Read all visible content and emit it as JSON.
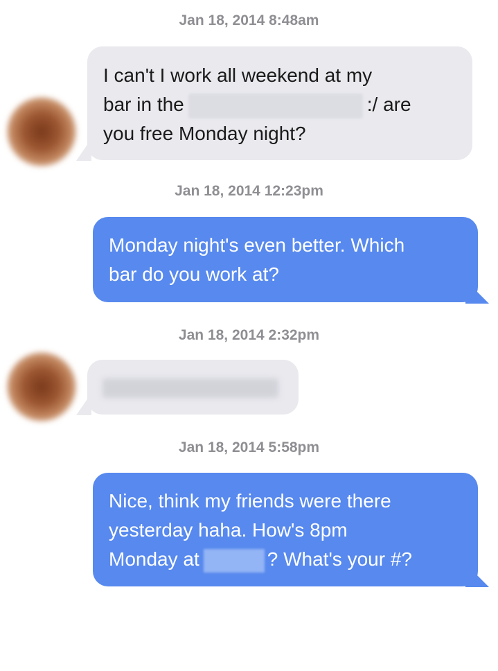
{
  "conversation": {
    "messages": [
      {
        "timestamp": "Jan 18, 2014 8:48am",
        "sender": "them",
        "line1": "I can't I work all weekend at my",
        "line2_before": "bar in the",
        "line2_after": ":/ are",
        "line3": "you free Monday night?"
      },
      {
        "timestamp": "Jan 18, 2014 12:23pm",
        "sender": "me",
        "line1": "Monday night's even better. Which",
        "line2": "bar do you work at?"
      },
      {
        "timestamp": "Jan 18, 2014 2:32pm",
        "sender": "them"
      },
      {
        "timestamp": "Jan 18, 2014 5:58pm",
        "sender": "me",
        "line1": "Nice, think my friends were there",
        "line2": "yesterday haha. How's 8pm",
        "line3_before": "Monday at",
        "line3_after": "? What's your #?"
      }
    ]
  },
  "colors": {
    "incoming_bubble": "#e9e9ee",
    "outgoing_bubble": "#5789ee",
    "timestamp": "#8e8e93"
  }
}
